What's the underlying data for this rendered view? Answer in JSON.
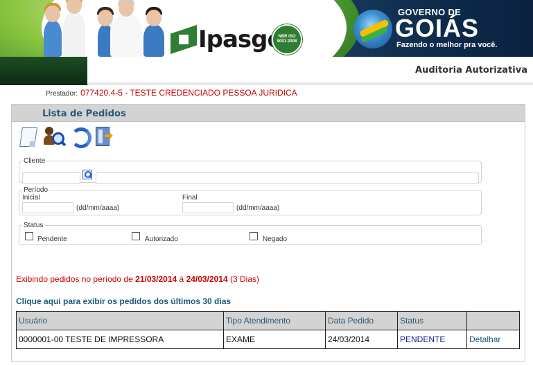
{
  "header": {
    "ipasgo_logo_text": "Ipasgo",
    "iso_seal_text": "NBR ISO 9001:2008",
    "gov_line1": "GOVERNO DE",
    "gov_line2": "GOIÁS",
    "gov_slogan": "Fazendo o melhor pra você.",
    "module_title": "Auditoria Autorizativa"
  },
  "prestador": {
    "label": "Prestador:",
    "value": "077420.4-5 - TESTE CREDENCIADO PESSOA JURIDICA"
  },
  "panel": {
    "title": "Lista de Pedidos",
    "toolbar": [
      "new-document-icon",
      "search-person-icon",
      "refresh-icon",
      "exit-icon"
    ]
  },
  "filters": {
    "cliente": {
      "legend": "Cliente",
      "code_value": "",
      "name_value": ""
    },
    "periodo": {
      "legend": "Período",
      "inicial_label": "Inicial",
      "inicial_value": "",
      "final_label": "Final",
      "final_value": "",
      "format_hint": "(dd/mm/aaaa)"
    },
    "status": {
      "legend": "Status",
      "options": [
        {
          "label": "Pendente",
          "checked": false
        },
        {
          "label": "Autorizado",
          "checked": false
        },
        {
          "label": "Negado",
          "checked": false
        }
      ]
    }
  },
  "period_message": {
    "prefix": "Exibindo pedidos no período de",
    "start": "21/03/2014",
    "connector": "à",
    "end": "24/03/2014",
    "days": "(3 Dias)"
  },
  "last30_link": "Clique aqui para exibir os pedidos dos últimos 30 dias",
  "table": {
    "columns": [
      "Usuário",
      "Tipo Atendimento",
      "Data Pedido",
      "Status",
      ""
    ],
    "rows": [
      {
        "usuario": "0000001-00 TESTE DE IMPRESSORA",
        "tipo": "EXAME",
        "data": "24/03/2014",
        "status": "PENDENTE",
        "action": "Detalhar"
      }
    ]
  }
}
